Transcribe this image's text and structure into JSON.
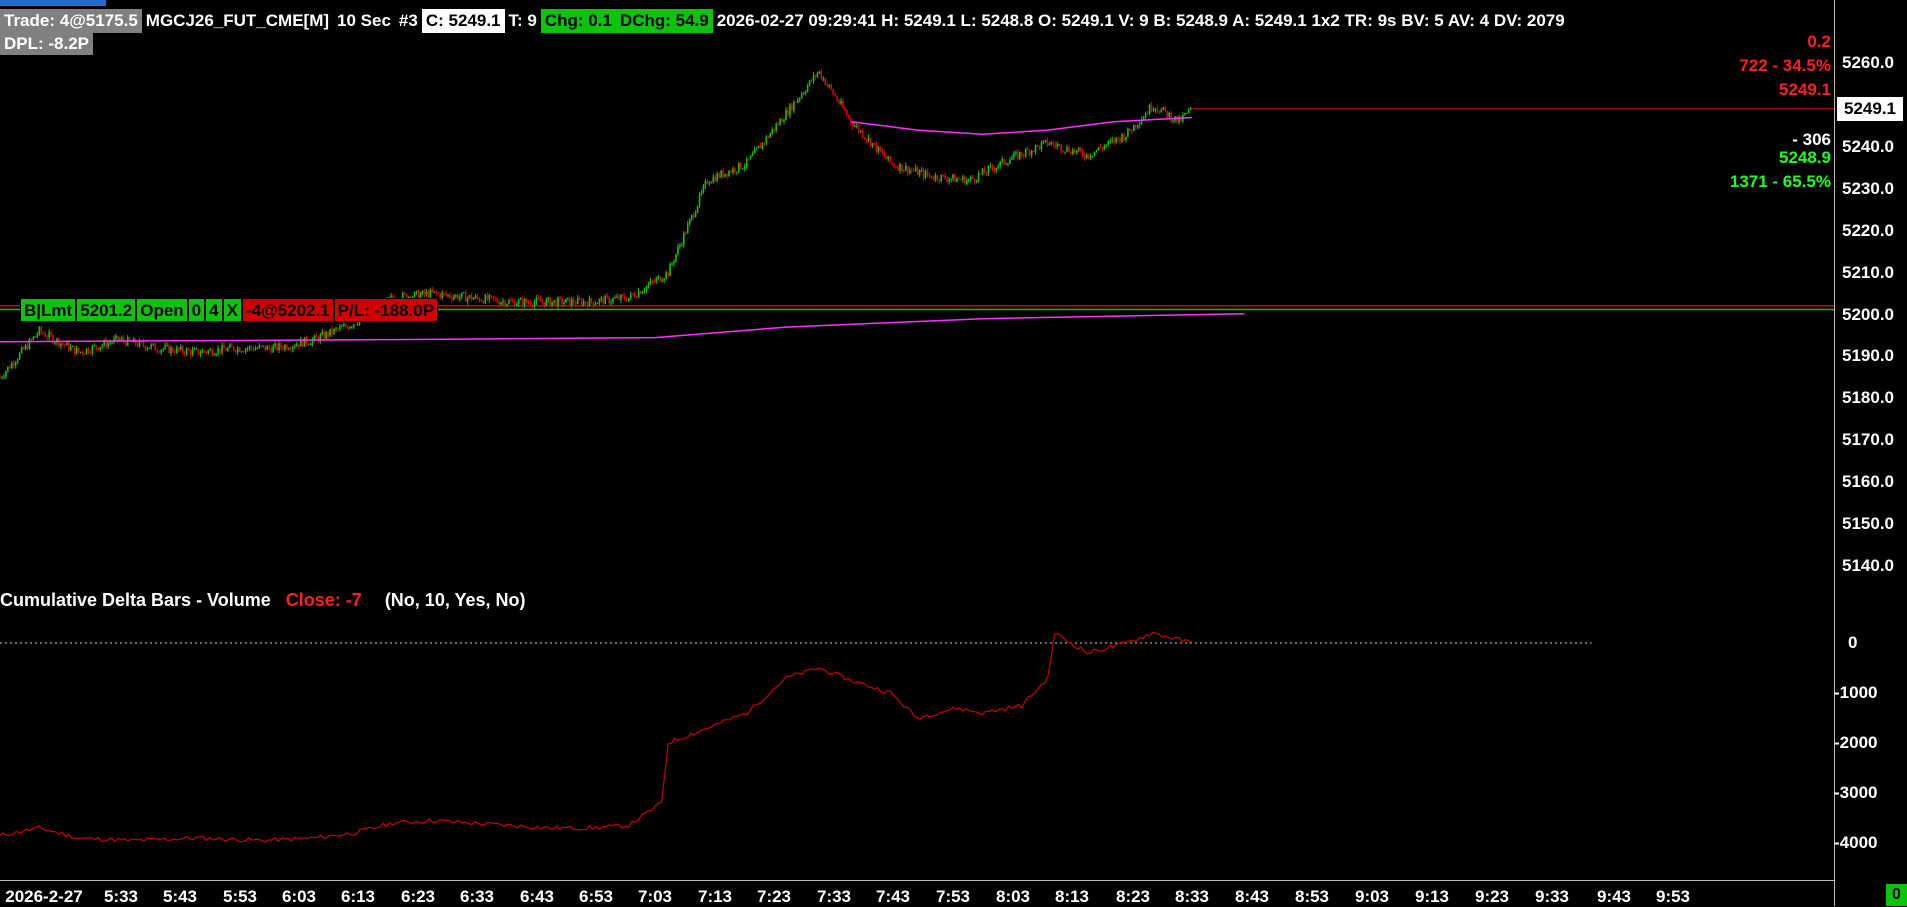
{
  "header": {
    "trade": "Trade: 4@5175.5",
    "symbol": "MGCJ26_FUT_CME[M]",
    "interval": "10 Sec",
    "chart_num": "#3",
    "close": "C: 5249.1",
    "ticks": "T: 9",
    "chg": "Chg: 0.1",
    "dchg": "DChg: 54.9",
    "stats": "2026-02-27 09:29:41 H: 5249.1 L: 5248.8 O: 5249.1 V: 9 B: 5248.9 A: 5249.1 1x2 TR: 9s BV: 5 AV: 4 DV: 2079",
    "dpl": "DPL: -8.2P"
  },
  "order": {
    "side": "B",
    "type": "Lmt",
    "price": "5201.2",
    "status": "Open",
    "zero": "0",
    "qty": "4",
    "cancel": "X",
    "position": "-4@5202.1",
    "pl": "P/L: -188.0P"
  },
  "right_labels": {
    "spread": "0.2",
    "ask_vol": "722 - 34.5%",
    "ask": "5249.1",
    "last": "5249.1",
    "delta": "- 306",
    "bid": "5248.9",
    "bid_vol": "1371 - 65.5%"
  },
  "indicator": {
    "name": "Cumulative Delta Bars - Volume",
    "close": "Close: -7",
    "params": "(No, 10, Yes, No)",
    "last_box": "0"
  },
  "colors": {
    "up": "#0cc40c",
    "down": "#e00000",
    "ma": "#ff30ff",
    "delta_line": "#cc0000",
    "order_green": "#0cc40c",
    "order_red": "#d00000"
  },
  "chart_data": [
    {
      "type": "candlestick",
      "y_ticks": [
        "5260.0",
        "5240.0",
        "5230.0",
        "5220.0",
        "5210.0",
        "5200.0",
        "5190.0",
        "5180.0",
        "5170.0",
        "5160.0",
        "5150.0",
        "5140.0"
      ],
      "x_labels": [
        "2026-2-27",
        "5:33",
        "5:43",
        "5:53",
        "6:03",
        "6:13",
        "6:23",
        "6:33",
        "6:43",
        "6:53",
        "7:03",
        "7:13",
        "7:23",
        "7:33",
        "7:43",
        "7:53",
        "8:03",
        "8:13",
        "8:23",
        "8:33",
        "8:43",
        "8:53",
        "9:03",
        "9:13",
        "9:23",
        "9:33",
        "9:43",
        "9:53"
      ],
      "ylim": [
        5133,
        5265
      ],
      "x_range_min": [
        0,
        280
      ],
      "price_path": [
        [
          0,
          5185
        ],
        [
          6,
          5196
        ],
        [
          12,
          5191
        ],
        [
          18,
          5194
        ],
        [
          24,
          5192
        ],
        [
          30,
          5191
        ],
        [
          36,
          5192
        ],
        [
          42,
          5192
        ],
        [
          48,
          5194
        ],
        [
          54,
          5198
        ],
        [
          60,
          5204
        ],
        [
          66,
          5205
        ],
        [
          72,
          5204
        ],
        [
          78,
          5203
        ],
        [
          84,
          5203
        ],
        [
          90,
          5203
        ],
        [
          96,
          5204
        ],
        [
          102,
          5210
        ],
        [
          108,
          5232
        ],
        [
          114,
          5236
        ],
        [
          120,
          5248
        ],
        [
          125,
          5258
        ],
        [
          130,
          5246
        ],
        [
          136,
          5236
        ],
        [
          142,
          5233
        ],
        [
          148,
          5232
        ],
        [
          154,
          5237
        ],
        [
          160,
          5241
        ],
        [
          166,
          5238
        ],
        [
          172,
          5243
        ],
        [
          176,
          5250
        ],
        [
          180,
          5246
        ],
        [
          182,
          5249.1
        ]
      ],
      "moving_average": [
        [
          0,
          5193.5
        ],
        [
          60,
          5194
        ],
        [
          100,
          5194.5
        ],
        [
          120,
          5197
        ],
        [
          150,
          5199
        ],
        [
          190,
          5200.2
        ]
      ],
      "ma_recent": [
        [
          130,
          5246
        ],
        [
          140,
          5244
        ],
        [
          150,
          5243
        ],
        [
          160,
          5244
        ],
        [
          170,
          5246
        ],
        [
          182,
          5247
        ]
      ],
      "order_lines": [
        5202.1,
        5201.2
      ],
      "last_price": 5249.1
    },
    {
      "type": "line",
      "name": "Cumulative Delta Bars - Volume",
      "y_ticks": [
        "0",
        "-1000",
        "-2000",
        "-3000",
        "-4000"
      ],
      "ylim": [
        -4400,
        300
      ],
      "zero_line": 0,
      "x_range_min": [
        0,
        280
      ],
      "values": [
        [
          0,
          -3850
        ],
        [
          6,
          -3700
        ],
        [
          12,
          -3900
        ],
        [
          20,
          -3950
        ],
        [
          30,
          -3900
        ],
        [
          40,
          -3950
        ],
        [
          48,
          -3900
        ],
        [
          54,
          -3800
        ],
        [
          60,
          -3600
        ],
        [
          66,
          -3550
        ],
        [
          72,
          -3600
        ],
        [
          78,
          -3650
        ],
        [
          84,
          -3700
        ],
        [
          90,
          -3700
        ],
        [
          96,
          -3650
        ],
        [
          101,
          -3200
        ],
        [
          102,
          -2000
        ],
        [
          108,
          -1700
        ],
        [
          114,
          -1400
        ],
        [
          120,
          -700
        ],
        [
          125,
          -500
        ],
        [
          130,
          -750
        ],
        [
          136,
          -1000
        ],
        [
          140,
          -1500
        ],
        [
          146,
          -1300
        ],
        [
          150,
          -1400
        ],
        [
          156,
          -1250
        ],
        [
          160,
          -700
        ],
        [
          161,
          200
        ],
        [
          166,
          -200
        ],
        [
          172,
          0
        ],
        [
          176,
          200
        ],
        [
          182,
          0
        ]
      ]
    }
  ]
}
